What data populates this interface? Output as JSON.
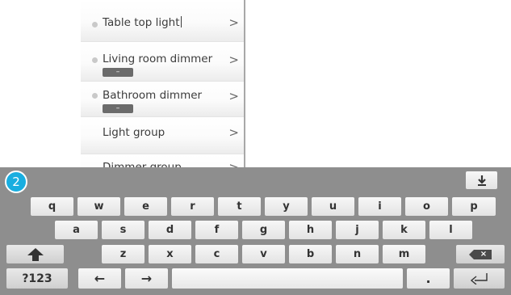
{
  "list": {
    "items": [
      {
        "label": "Table top light",
        "has_dot": true,
        "chip": null
      },
      {
        "label": "Living room dimmer",
        "has_dot": true,
        "chip": "–"
      },
      {
        "label": "Bathroom dimmer",
        "has_dot": true,
        "chip": "–"
      },
      {
        "label": "Light group",
        "has_dot": false,
        "chip": null
      },
      {
        "label": "Dimmer group",
        "has_dot": false,
        "chip": null
      }
    ],
    "chevron": ">"
  },
  "keyboard": {
    "step_badge": "2",
    "hide_icon": "hide-keyboard-icon",
    "row1": [
      "q",
      "w",
      "e",
      "r",
      "t",
      "y",
      "u",
      "i",
      "o",
      "p"
    ],
    "row2": [
      "a",
      "s",
      "d",
      "f",
      "g",
      "h",
      "j",
      "k",
      "l"
    ],
    "row3": [
      "z",
      "x",
      "c",
      "v",
      "b",
      "n",
      "m"
    ],
    "shift_icon": "shift-up-arrow-icon",
    "backspace_icon": "backspace-icon",
    "backspace_label": "×",
    "symbols_label": "?123",
    "left_arrow": "←",
    "right_arrow": "→",
    "period_label": ".",
    "enter_icon": "enter-return-icon"
  }
}
